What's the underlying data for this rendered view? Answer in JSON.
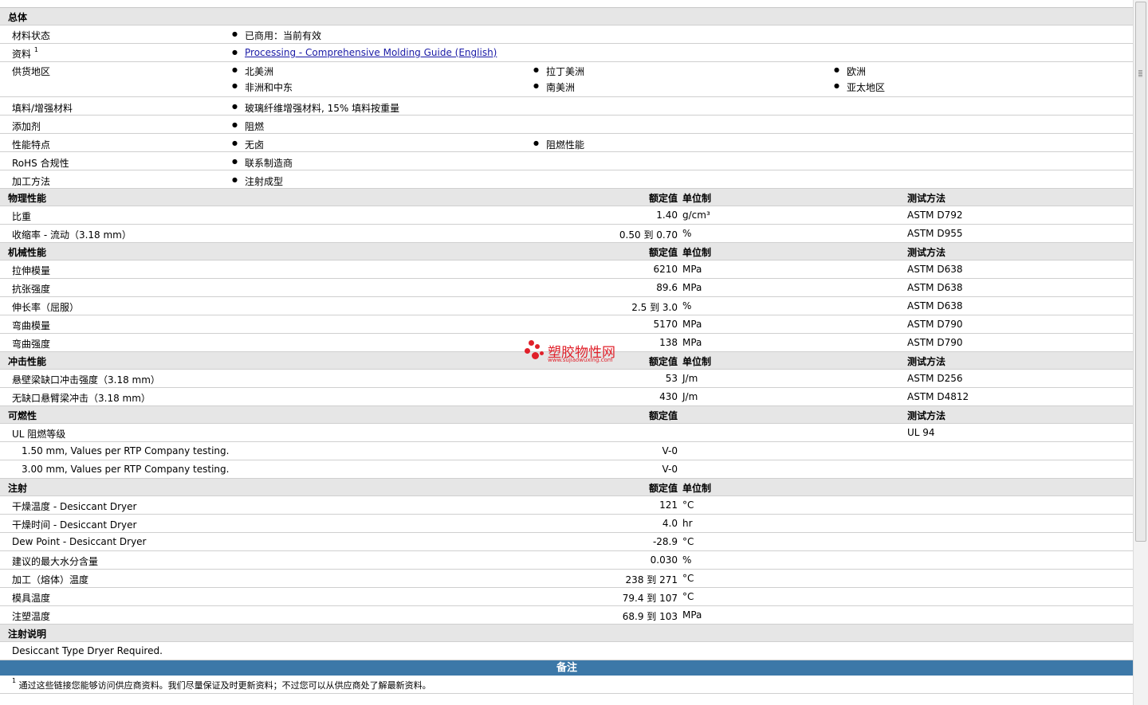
{
  "general": {
    "title": "总体",
    "rows": [
      {
        "label": "材料状态",
        "bullets": [
          [
            "已商用：当前有效"
          ]
        ]
      },
      {
        "label": "资料",
        "sup": "1",
        "link": "Processing - Comprehensive Molding Guide (English)"
      },
      {
        "label": "供货地区",
        "bullets": [
          [
            "北美洲",
            "拉丁美洲",
            "欧洲"
          ],
          [
            "非洲和中东",
            "南美洲",
            "亚太地区"
          ]
        ]
      },
      {
        "label": "填料/增强材料",
        "bullets": [
          [
            "玻璃纤维增强材料, 15% 填料按重量"
          ]
        ]
      },
      {
        "label": "添加剂",
        "bullets": [
          [
            "阻燃"
          ]
        ]
      },
      {
        "label": "性能特点",
        "bullets": [
          [
            "无卤",
            "阻燃性能"
          ]
        ]
      },
      {
        "label": "RoHS 合规性",
        "bullets": [
          [
            "联系制造商"
          ]
        ]
      },
      {
        "label": "加工方法",
        "bullets": [
          [
            "注射成型"
          ]
        ]
      }
    ]
  },
  "headers": {
    "nominal": "额定值",
    "unit": "单位制",
    "test": "测试方法"
  },
  "sections": [
    {
      "title": "物理性能",
      "show_unit": true,
      "show_test": true,
      "rows": [
        {
          "label": "比重",
          "nominal": "1.40",
          "unit": "g/cm³",
          "test": "ASTM D792"
        },
        {
          "label": "收缩率  - 流动（3.18 mm）",
          "nominal": "0.50 到  0.70",
          "unit": "%",
          "test": "ASTM D955"
        }
      ]
    },
    {
      "title": "机械性能",
      "show_unit": true,
      "show_test": true,
      "rows": [
        {
          "label": "拉伸模量",
          "nominal": "6210",
          "unit": "MPa",
          "test": "ASTM D638"
        },
        {
          "label": "抗张强度",
          "nominal": "89.6",
          "unit": "MPa",
          "test": "ASTM D638"
        },
        {
          "label": "伸长率（屈服）",
          "nominal": "2.5 到  3.0",
          "unit": "%",
          "test": "ASTM D638"
        },
        {
          "label": "弯曲模量",
          "nominal": "5170",
          "unit": "MPa",
          "test": "ASTM D790"
        },
        {
          "label": "弯曲强度",
          "nominal": "138",
          "unit": "MPa",
          "test": "ASTM D790"
        }
      ]
    },
    {
      "title": "冲击性能",
      "show_unit": true,
      "show_test": true,
      "rows": [
        {
          "label": "悬壁梁缺口冲击强度（3.18 mm）",
          "nominal": "53",
          "unit": "J/m",
          "test": "ASTM D256"
        },
        {
          "label": "无缺口悬臂梁冲击（3.18 mm）",
          "nominal": "430",
          "unit": "J/m",
          "test": "ASTM D4812"
        }
      ]
    },
    {
      "title": "可燃性",
      "show_unit": false,
      "show_test": true,
      "rows": [
        {
          "label": "UL 阻燃等级",
          "nominal": "",
          "unit": "",
          "test": "UL 94"
        },
        {
          "label": "1.50 mm, Values per RTP Company testing.",
          "indent": true,
          "nominal": "V-0",
          "unit": "",
          "test": ""
        },
        {
          "label": "3.00 mm, Values per RTP Company testing.",
          "indent": true,
          "nominal": "V-0",
          "unit": "",
          "test": ""
        }
      ]
    },
    {
      "title": "注射",
      "show_unit": true,
      "show_test": false,
      "rows": [
        {
          "label": "干燥温度  - Desiccant Dryer",
          "nominal": "121",
          "unit": "°C",
          "test": ""
        },
        {
          "label": "干燥时间  - Desiccant Dryer",
          "nominal": "4.0",
          "unit": "hr",
          "test": ""
        },
        {
          "label": "Dew Point - Desiccant Dryer",
          "nominal": "-28.9",
          "unit": "°C",
          "test": ""
        },
        {
          "label": "建议的最大水分含量",
          "nominal": "0.030",
          "unit": "%",
          "test": ""
        },
        {
          "label": "加工（熔体）温度",
          "nominal": "238 到  271",
          "unit": "°C",
          "test": ""
        },
        {
          "label": "模具温度",
          "nominal": "79.4 到  107",
          "unit": "°C",
          "test": ""
        },
        {
          "label": "注塑温度",
          "nominal": "68.9 到  103",
          "unit": "MPa",
          "test": ""
        }
      ]
    }
  ],
  "injection_notes": {
    "title": "注射说明",
    "text": "Desiccant Type Dryer Required."
  },
  "notes": {
    "title": "备注",
    "sup": "1",
    "text": "通过这些链接您能够访问供应商资料。我们尽量保证及时更新资料；不过您可以从供应商处了解最新资料。"
  },
  "watermark": {
    "name": "塑胶物性网",
    "url": "www.sujiaowuxing.com"
  }
}
